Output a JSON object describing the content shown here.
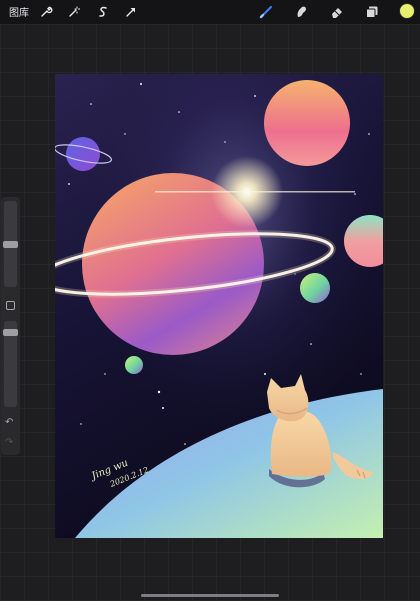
{
  "topbar": {
    "gallery_label": "图库",
    "left_tools": [
      "wrench-icon",
      "magic-wand-icon",
      "selection-s-icon",
      "transform-arrow-icon"
    ],
    "right_tools": [
      "brush-icon",
      "smudge-icon",
      "eraser-icon",
      "layers-icon"
    ],
    "active_tool": "brush-icon",
    "current_color": "#e5f06e"
  },
  "sidebar": {
    "brush_size_level": 0.5,
    "opacity_level": 0.1,
    "undo_icon": "undo-icon",
    "redo_icon": "redo-icon"
  },
  "artwork": {
    "signature_name": "Jing wu",
    "signature_date": "2020.2.12"
  }
}
